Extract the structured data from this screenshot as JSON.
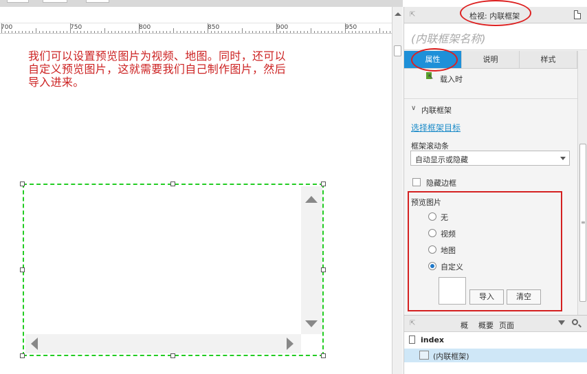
{
  "ruler": {
    "labels": [
      "700",
      "750",
      "800",
      "850",
      "900",
      "950"
    ]
  },
  "canvas": {
    "note_line1": "我们可以设置预览图片为视频、地图。同时，还可以",
    "note_line2": "自定义预览图片，这就需要我们自己制作图片，然后",
    "note_line3": "导入进来。"
  },
  "inspector": {
    "title": "检视: 内联框架",
    "name_placeholder": "(内联框架名称)",
    "tabs": [
      "属性",
      "说明",
      "样式"
    ],
    "active_tab": "属性",
    "on_load_label": "载入时",
    "section_title": "内联框架",
    "select_target_link": "选择框架目标",
    "scroll_label": "框架滚动条",
    "scroll_value": "自动显示或隐藏",
    "hide_border_label": "隐藏边框",
    "preview_label": "预览图片",
    "preview_options": [
      "无",
      "视频",
      "地图",
      "自定义"
    ],
    "preview_selected": "自定义",
    "import_button": "导入",
    "clear_button": "清空"
  },
  "outline": {
    "tabs": [
      "概",
      "概要",
      "页面"
    ],
    "index_label": "index",
    "item_label": "(内联框架)"
  },
  "colors": {
    "accent": "#1e90d8",
    "annotation_red": "#dd2020",
    "selection_green": "#22cc22",
    "note_red": "#cc2222"
  },
  "icons": {
    "collapse": "collapse-arrow-icon",
    "page": "page-icon",
    "filter": "filter-icon",
    "search": "search-icon",
    "cursor": "cursor-flag-icon",
    "chevron": "chevron-down-icon"
  }
}
